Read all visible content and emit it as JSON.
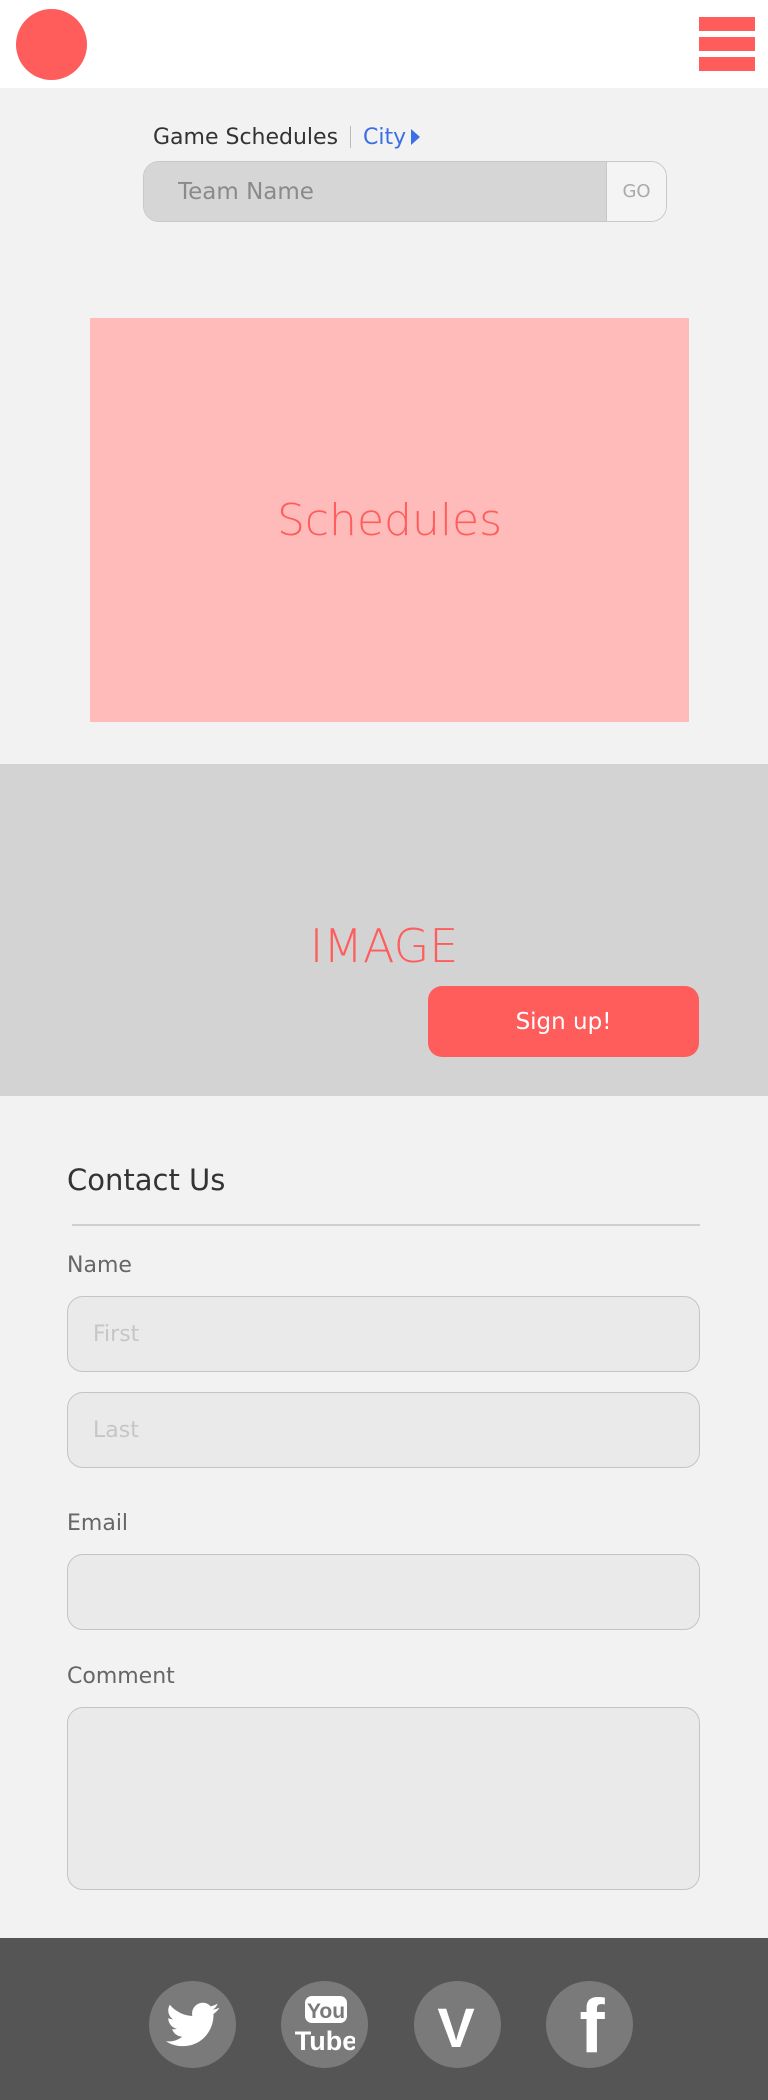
{
  "breadcrumb": {
    "title": "Game Schedules",
    "city": "City"
  },
  "search": {
    "placeholder": "Team Name",
    "go_label": "GO"
  },
  "schedules": {
    "label": "Schedules"
  },
  "hero": {
    "label": "IMAGE",
    "signup_label": "Sign up!"
  },
  "contact": {
    "title": "Contact Us",
    "name_label": "Name",
    "first_placeholder": "First",
    "last_placeholder": "Last",
    "email_label": "Email",
    "comment_label": "Comment"
  },
  "social": {
    "icons": [
      "twitter-icon",
      "youtube-icon",
      "vine-icon",
      "facebook-icon"
    ],
    "youtube_text": {
      "top": "You",
      "bottom": "Tube"
    },
    "vine_text": "V",
    "facebook_text": "f"
  },
  "colors": {
    "accent": "#ff5c5c",
    "accent_light": "#ffbaba",
    "link": "#3a6fe8",
    "footer": "#555555",
    "icon_circle": "#7a7a7a"
  }
}
